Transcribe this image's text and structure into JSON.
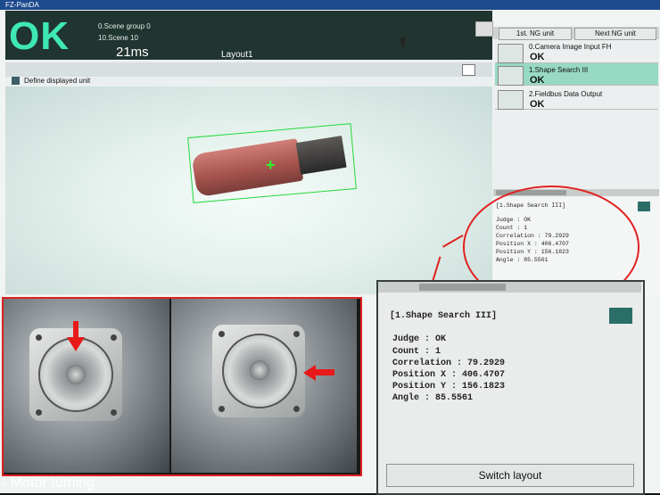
{
  "window": {
    "title": "FZ-PanDA"
  },
  "header": {
    "judge": "OK",
    "scene_group": "0.Scene group 0",
    "scene": "10.Scene 10",
    "processing_time": "21ms",
    "layout": "Layout1"
  },
  "nav": {
    "first_ng": "1st. NG unit",
    "next_ng": "Next NG unit"
  },
  "image_area": {
    "define_label": "Define displayed unit"
  },
  "flow": {
    "items": [
      {
        "title": "0.Camera Image Input FH",
        "status": "OK",
        "icon": "camera-icon"
      },
      {
        "title": "1.Shape Search III",
        "status": "OK",
        "icon": "shape-search-icon"
      },
      {
        "title": "2.Fieldbus Data Output",
        "status": "OK",
        "icon": "fieldbus-icon"
      }
    ]
  },
  "detail": {
    "heading": "[1.Shape Search III]",
    "lines": [
      "Judge : OK",
      "Count : 1",
      "Correlation : 79.2929",
      "Position X : 406.4707",
      "Position Y : 156.1823",
      "Angle : 85.5561"
    ]
  },
  "zoom": {
    "heading": "[1.Shape Search III]",
    "switch_layout": "Switch layout"
  },
  "photo": {
    "caption": "- Motor turning"
  },
  "colors": {
    "ok_green": "#3ee8b3",
    "annotation_red": "#e12020",
    "selected_row": "#98d9c4",
    "search_box": "#23d93a"
  }
}
